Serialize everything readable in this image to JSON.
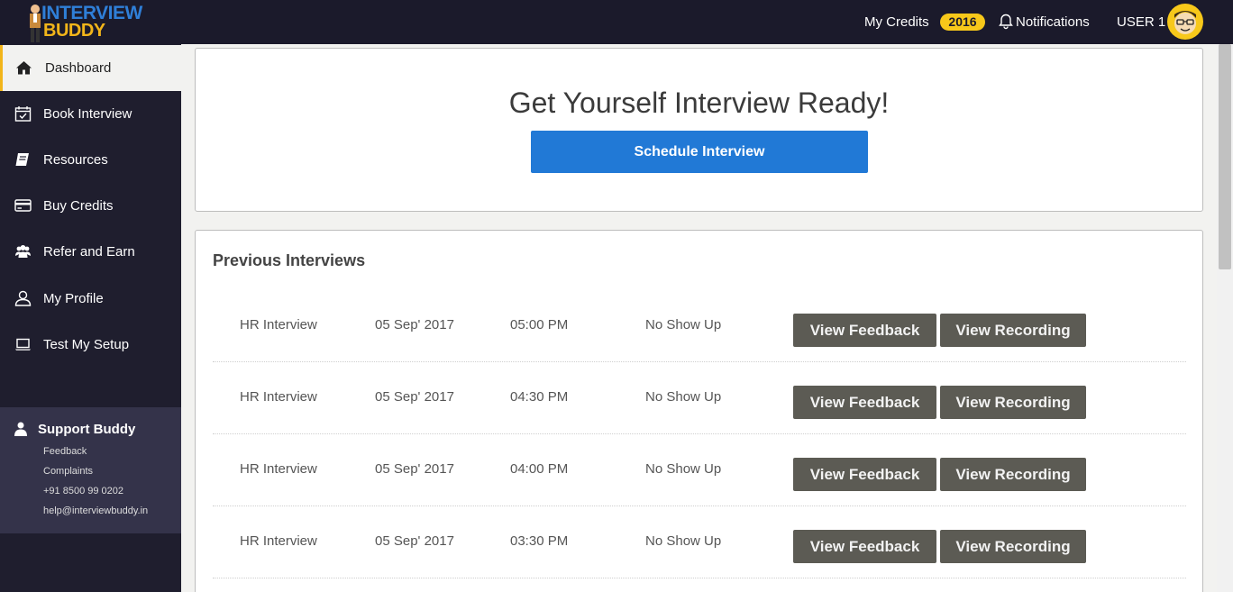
{
  "header": {
    "logo_line1": "INTERVIEW",
    "logo_line2": "BUDDY",
    "credits_label": "My Credits",
    "credits_value": "2016",
    "notifications_label": "Notifications",
    "user_label": "USER 1"
  },
  "sidebar": {
    "items": [
      {
        "label": "Dashboard",
        "icon": "home-icon",
        "active": true
      },
      {
        "label": "Book Interview",
        "icon": "calendar-check-icon"
      },
      {
        "label": "Resources",
        "icon": "book-icon"
      },
      {
        "label": "Buy Credits",
        "icon": "credit-card-icon"
      },
      {
        "label": "Refer and Earn",
        "icon": "users-icon"
      },
      {
        "label": "My Profile",
        "icon": "user-outline-icon"
      },
      {
        "label": "Test My Setup",
        "icon": "laptop-icon"
      }
    ],
    "support": {
      "title": "Support Buddy",
      "lines": [
        "Feedback",
        "Complaints",
        "+91 8500 99 0202",
        "help@interviewbuddy.in"
      ]
    }
  },
  "hero": {
    "title": "Get Yourself Interview Ready!",
    "button_label": "Schedule Interview"
  },
  "previous": {
    "title": "Previous Interviews",
    "feedback_label": "View Feedback",
    "recording_label": "View Recording",
    "rows": [
      {
        "type": "HR Interview",
        "date": "05 Sep' 2017",
        "time": "05:00 PM",
        "status": "No Show Up"
      },
      {
        "type": "HR Interview",
        "date": "05 Sep' 2017",
        "time": "04:30 PM",
        "status": "No Show Up"
      },
      {
        "type": "HR Interview",
        "date": "05 Sep' 2017",
        "time": "04:00 PM",
        "status": "No Show Up"
      },
      {
        "type": "HR Interview",
        "date": "05 Sep' 2017",
        "time": "03:30 PM",
        "status": "No Show Up"
      }
    ]
  },
  "colors": {
    "header_bg": "#1b1a2b",
    "sidebar_bg": "#1f1e2e",
    "accent_yellow": "#f7c81a",
    "primary_blue": "#2179d6",
    "button_dark": "#5c5b54"
  }
}
